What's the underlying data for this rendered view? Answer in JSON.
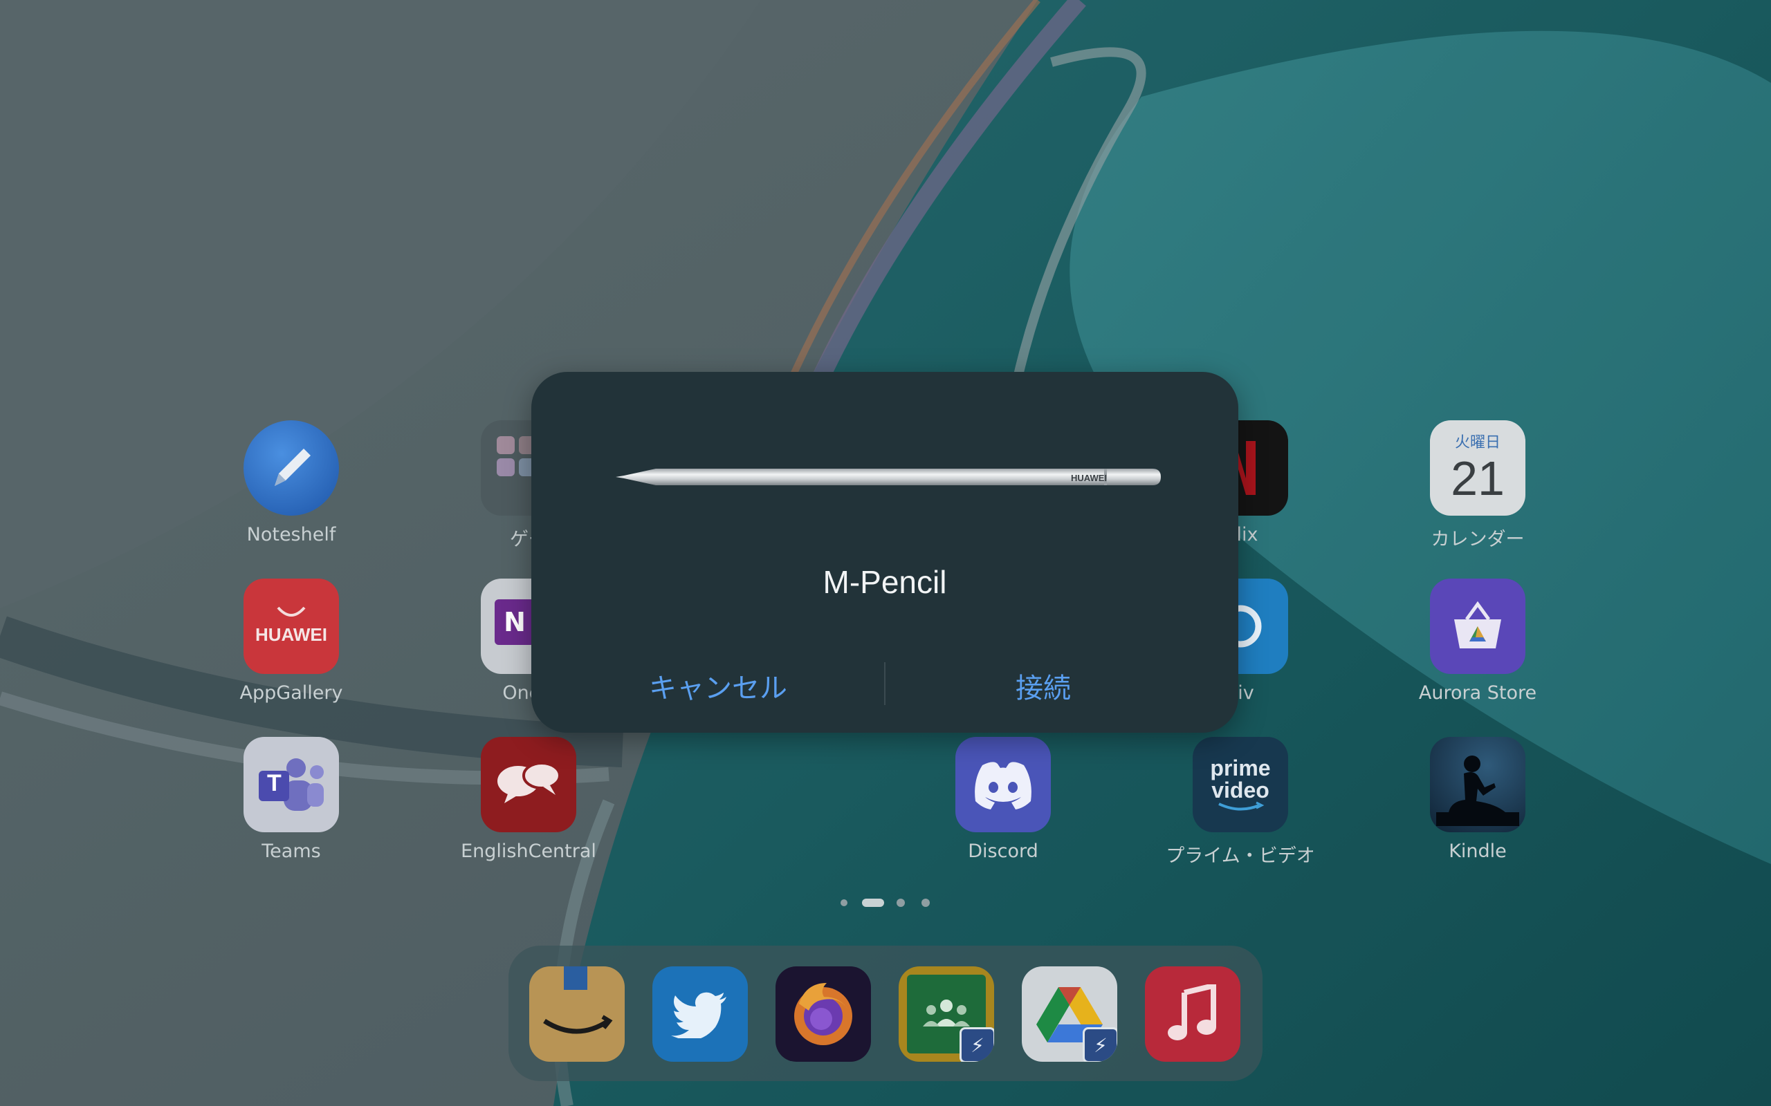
{
  "home_screen": {
    "apps": [
      {
        "name": "Noteshelf",
        "label": "Noteshelf"
      },
      {
        "name": "games-folder",
        "label": "ゲー"
      },
      {
        "name": "netflix",
        "label": "tflix"
      },
      {
        "name": "calendar",
        "label": "カレンダー"
      },
      {
        "name": "appgallery",
        "label": "AppGallery"
      },
      {
        "name": "onenote",
        "label": "OneN"
      },
      {
        "name": "pixiv",
        "label": "xiv"
      },
      {
        "name": "aurora-store",
        "label": "Aurora Store"
      },
      {
        "name": "teams",
        "label": "Teams"
      },
      {
        "name": "englishcentral",
        "label": "EnglishCentral"
      },
      {
        "name": "discord",
        "label": "Discord"
      },
      {
        "name": "prime-video",
        "label": "プライム・ビデオ"
      },
      {
        "name": "kindle",
        "label": "Kindle"
      }
    ],
    "calendar_icon": {
      "weekday": "火曜日",
      "day": "21"
    },
    "appgallery_icon_text": "HUAWEI",
    "onenote_icon_text": "N",
    "teams_icon_text": "T",
    "prime_icon_text": {
      "line1": "prime",
      "line2": "video"
    },
    "page_indicator": {
      "pages": 4,
      "current": 1
    }
  },
  "dock": {
    "apps": [
      "amazon",
      "twitter",
      "firefox",
      "google-classroom",
      "google-drive",
      "music"
    ]
  },
  "dialog": {
    "pen_brand": "HUAWEI",
    "device_name": "M-Pencil",
    "cancel_label": "キャンセル",
    "connect_label": "接続",
    "accent_color": "#5a9ff0"
  }
}
